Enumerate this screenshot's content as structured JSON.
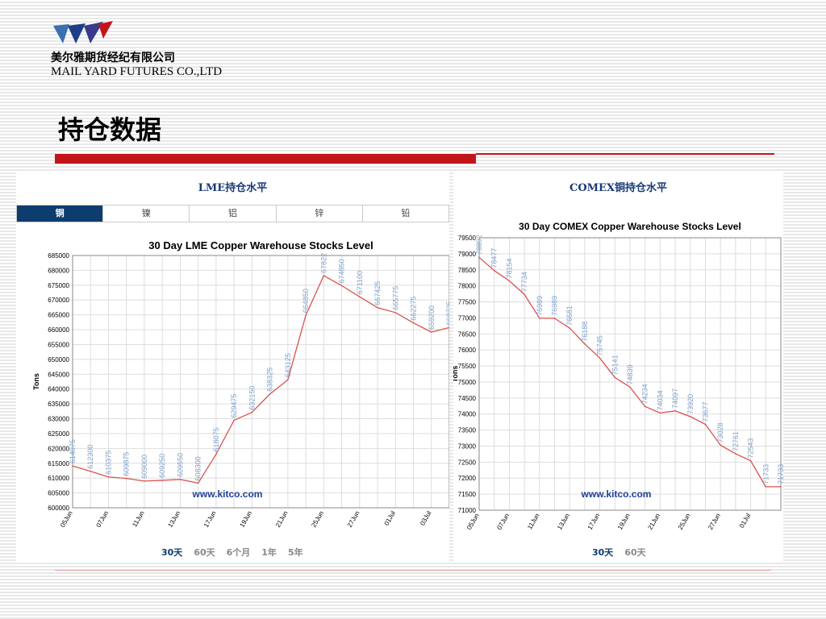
{
  "header": {
    "company_cn": "美尔雅期货经纪有限公司",
    "company_en": "MAIL YARD FUTURES CO.,LTD",
    "page_title": "持仓数据",
    "brand_color": "#c4141b"
  },
  "left_panel": {
    "title": "LME持仓水平",
    "tabs": [
      "铜",
      "镍",
      "铝",
      "锌",
      "铅"
    ],
    "active_tab": 0,
    "ranges": [
      "30天",
      "60天",
      "6个月",
      "1年",
      "5年"
    ],
    "active_range": 0
  },
  "right_panel": {
    "title": "COMEX铜持仓水平",
    "ranges": [
      "30天",
      "60天"
    ],
    "active_range": 0
  },
  "chart_data": [
    {
      "type": "line",
      "title": "30 Day LME Copper Warehouse Stocks Level",
      "ylabel": "Tons",
      "watermark": "www.kitco.com",
      "ylim": [
        600000,
        685000
      ],
      "ytick_step": 5000,
      "xtick_labels": [
        "05Jun",
        "07Jun",
        "11Jun",
        "13Jun",
        "17Jun",
        "19Jun",
        "21Jun",
        "25Jun",
        "27Jun",
        "01Jul",
        "03Jul"
      ],
      "values": [
        614075,
        612300,
        610375,
        609875,
        609000,
        609250,
        609550,
        608300,
        618075,
        629475,
        632150,
        638325,
        643125,
        664850,
        678225,
        674850,
        671100,
        667425,
        665775,
        662275,
        659200,
        660725
      ],
      "data_labels": [
        "614075",
        "612300",
        "610375",
        "609875",
        "609000",
        "609250",
        "609550",
        "608300",
        "618075",
        "629475",
        "632150",
        "638325",
        "643125",
        "664850",
        "67822",
        "674850",
        "671100",
        "667425",
        "665775",
        "662275",
        "659200",
        "660725"
      ],
      "line_color": "#d9534f",
      "label_color": "#7fa3cc",
      "grid": true
    },
    {
      "type": "line",
      "title": "30 Day COMEX Copper Warehouse Stocks Level",
      "ylabel": "Tons",
      "watermark": "www.kitco.com",
      "ylim": [
        71000,
        79500
      ],
      "ytick_step": 500,
      "xtick_labels": [
        "05Jun",
        "07Jun",
        "11Jun",
        "13Jun",
        "17Jun",
        "19Jun",
        "21Jun",
        "25Jun",
        "27Jun",
        "01Jul"
      ],
      "values": [
        78892,
        78477,
        78154,
        77734,
        76989,
        76989,
        76681,
        76188,
        75745,
        75141,
        74839,
        74234,
        74034,
        74097,
        73920,
        73677,
        73028,
        72761,
        72543,
        71733,
        71733
      ],
      "data_labels": [
        "78892",
        "78477",
        "78154",
        "77734",
        "76989",
        "76989",
        "76681",
        "76188",
        "75745",
        "75141",
        "74839",
        "74234",
        "74034",
        "74097",
        "73920",
        "73677",
        "73028",
        "72761",
        "72543",
        "71733",
        "71733"
      ],
      "line_color": "#d9534f",
      "label_color": "#7fa3cc",
      "grid": true
    }
  ]
}
